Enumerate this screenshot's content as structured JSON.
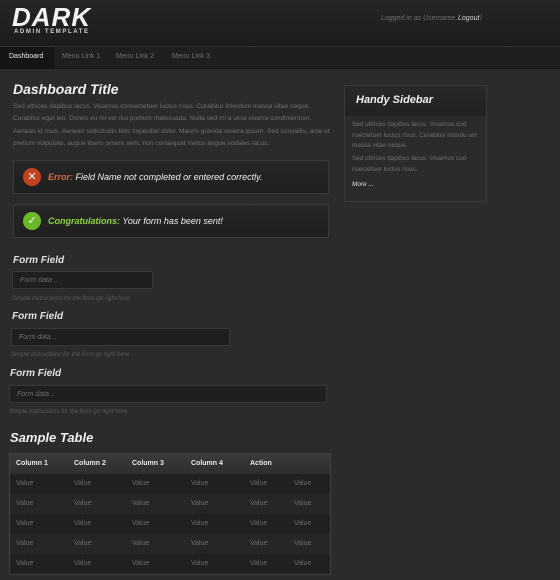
{
  "header": {
    "logo": "DARK",
    "logo_sub": "ADMIN TEMPLATE",
    "login_text": "Logged in as Username,",
    "logout": "Logout",
    "slash": "/"
  },
  "nav": {
    "items": [
      "Dashboard",
      "Menu Link 1",
      "Menu Link 2",
      "Menu Link 3"
    ]
  },
  "main": {
    "title": "Dashboard Title",
    "intro": "Sed ultrices dapibus lacus. Vivamus consectetuer luctus risus. Curabitur interdum massa vitae neque. Curabitur eget leo. Donec eu mi vel nisi pretium malesuada. Nulla sed mi a urna viverra condimentum. Aenean id risus. Aenean sollicitudin felis imperdiet dolor. Mauris gravida viverra ipsum. Sed convallis, ante et pretium vulputate, augue libero ornare sem, non consequat metus augue sodales lacus."
  },
  "messages": {
    "error_label": "Error:",
    "error_text": "Field Name not completed or entered correctly.",
    "success_label": "Congratulations:",
    "success_text": "Your form has been sent!"
  },
  "form": {
    "fields": [
      {
        "label": "Form Field",
        "placeholder": "Form data ..",
        "hint": "Simple instructions for the form go right here"
      },
      {
        "label": "Form Field",
        "placeholder": "Form data ..",
        "hint": "Simple instructions for the form go right here"
      },
      {
        "label": "Form Field",
        "placeholder": "Form data ..",
        "hint": "Simple instructions for the form go right here"
      }
    ]
  },
  "table": {
    "title": "Sample Table",
    "headers": [
      "Column 1",
      "Column 2",
      "Column 3",
      "Column 4",
      "Action",
      ""
    ],
    "rows": [
      [
        "Value",
        "Value",
        "Value",
        "Value",
        "Value",
        "Value"
      ],
      [
        "Value",
        "Value",
        "Value",
        "Value",
        "Value",
        "Value"
      ],
      [
        "Value",
        "Value",
        "Value",
        "Value",
        "Value",
        "Value"
      ],
      [
        "Value",
        "Value",
        "Value",
        "Value",
        "Value",
        "Value"
      ],
      [
        "Value",
        "Value",
        "Value",
        "Value",
        "Value",
        "Value"
      ]
    ]
  },
  "sidebar": {
    "title": "Handy Sidebar",
    "p1": "Sed ultrices dapibus lacus. Vivamus cod nsectetuer luctus risus. Curabitur interdu um massa vitae neque.",
    "p2": "Sed ultrices dapibus lacus. Vivamus cod nsectetuer luctus risus.",
    "more": "More ..."
  },
  "colors": {
    "error_accent": "#d76a3d",
    "success_accent": "#8ed43c",
    "background": "#2b2b2b"
  }
}
